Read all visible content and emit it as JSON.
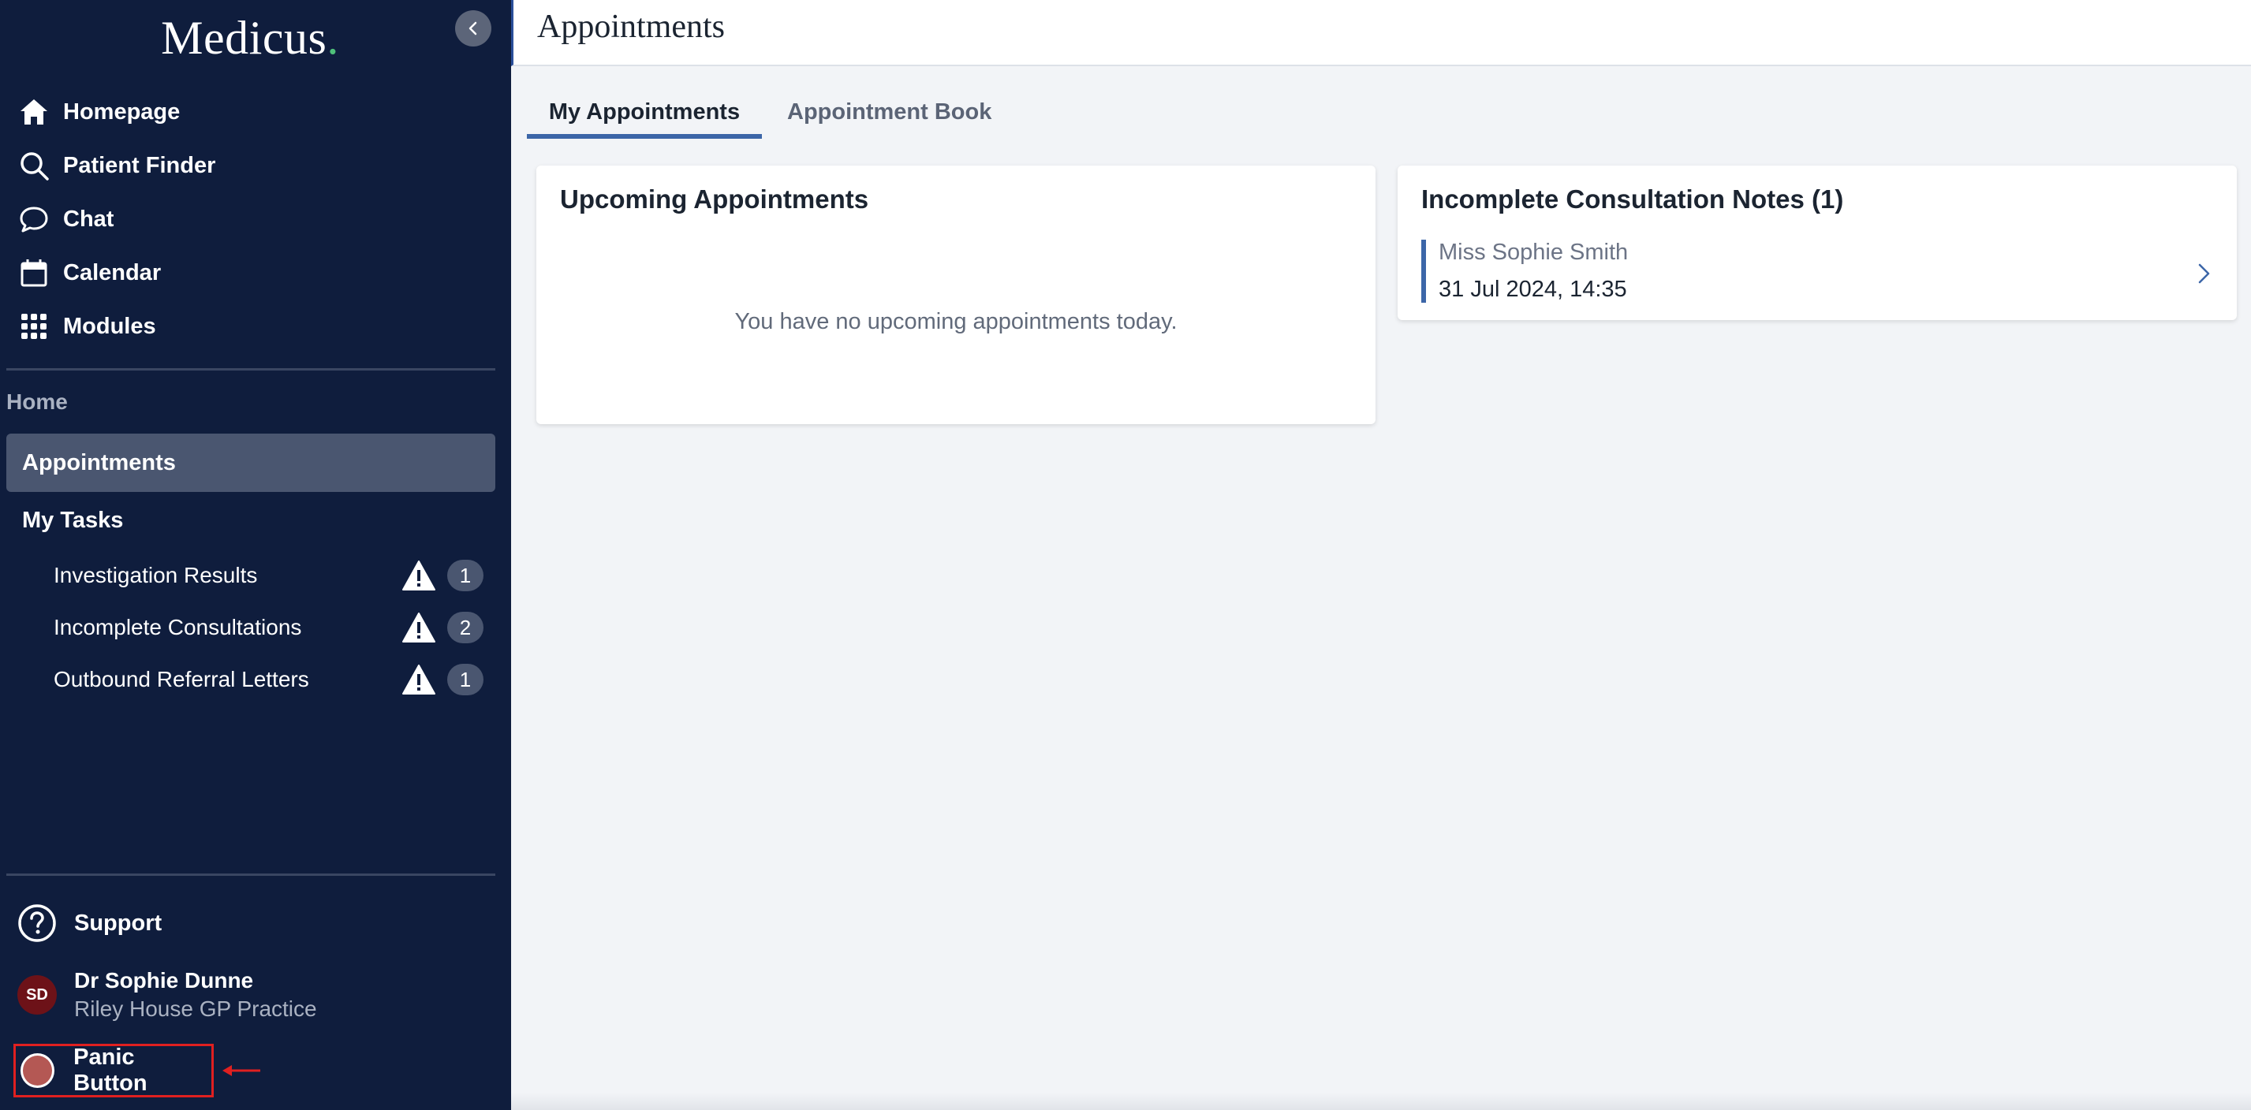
{
  "sidebar": {
    "logo": {
      "text": "Medicus",
      "dot": "."
    },
    "nav": [
      {
        "label": "Homepage",
        "icon": "home-icon"
      },
      {
        "label": "Patient Finder",
        "icon": "search-icon"
      },
      {
        "label": "Chat",
        "icon": "chat-bubble-icon"
      },
      {
        "label": "Calendar",
        "icon": "calendar-icon"
      },
      {
        "label": "Modules",
        "icon": "grid-icon"
      }
    ],
    "section_label": "Home",
    "active_item": "Appointments",
    "tasks_label": "My Tasks",
    "tasks": [
      {
        "label": "Investigation Results",
        "count": "1"
      },
      {
        "label": "Incomplete Consultations",
        "count": "2"
      },
      {
        "label": "Outbound Referral Letters",
        "count": "1"
      }
    ],
    "support_label": "Support",
    "user": {
      "initials": "SD",
      "name": "Dr Sophie Dunne",
      "practice": "Riley House GP Practice"
    },
    "panic_label": "Panic Button"
  },
  "header": {
    "title": "Appointments"
  },
  "tabs": [
    {
      "label": "My Appointments",
      "active": true
    },
    {
      "label": "Appointment Book",
      "active": false
    }
  ],
  "upcoming": {
    "title": "Upcoming Appointments",
    "empty_message": "You have no upcoming appointments today."
  },
  "incomplete": {
    "title": "Incomplete Consultation Notes (1)",
    "items": [
      {
        "patient": "Miss Sophie Smith",
        "datetime": "31 Jul 2024, 14:35"
      }
    ]
  },
  "colors": {
    "sidebar_bg": "#0f1d3d",
    "accent": "#3c66a8",
    "logo_dot": "#4fc07a",
    "panic_highlight": "#e02020"
  }
}
